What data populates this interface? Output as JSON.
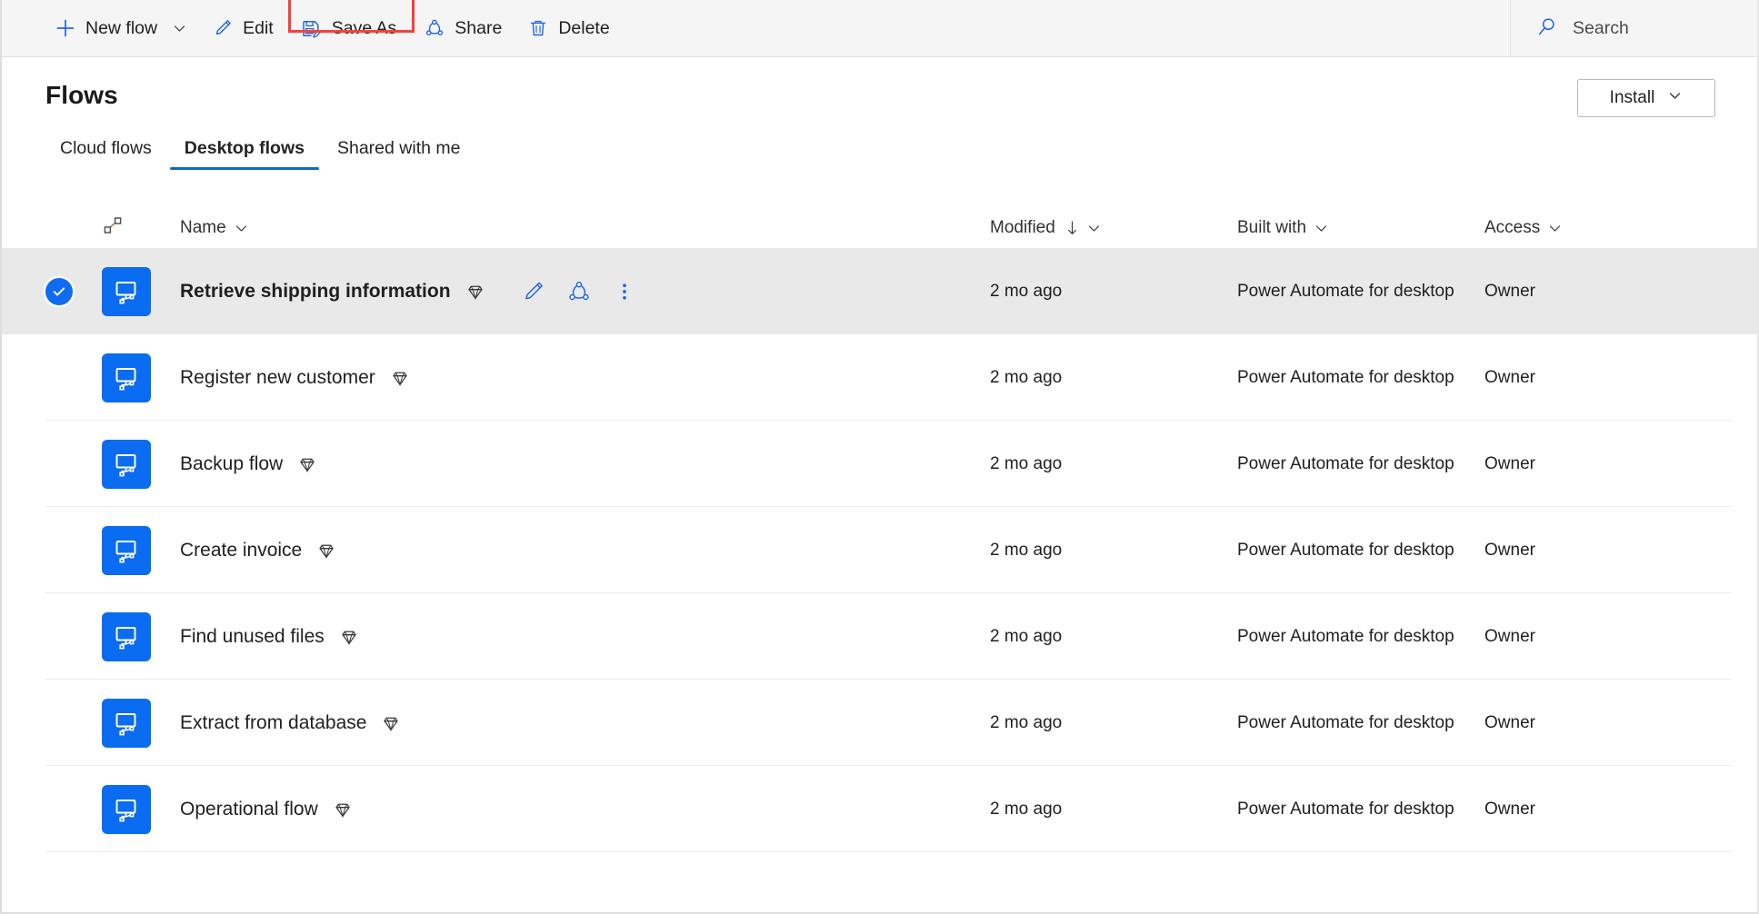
{
  "commandbar": {
    "items": [
      {
        "label": "New flow",
        "icon": "plus-icon",
        "has_caret": true
      },
      {
        "label": "Edit",
        "icon": "pencil-icon",
        "has_caret": false
      },
      {
        "label": "Save As",
        "icon": "save-as-icon",
        "has_caret": false,
        "highlighted": true
      },
      {
        "label": "Share",
        "icon": "share-icon",
        "has_caret": false
      },
      {
        "label": "Delete",
        "icon": "trash-icon",
        "has_caret": false
      }
    ],
    "search": {
      "label": "Search",
      "icon": "search-icon"
    },
    "highlight_color": "#f5413c"
  },
  "header": {
    "title": "Flows",
    "install_button": {
      "label": "Install",
      "icon": "chevron-down-icon"
    }
  },
  "tabs": [
    {
      "label": "Cloud flows",
      "active": false
    },
    {
      "label": "Desktop flows",
      "active": true
    },
    {
      "label": "Shared with me",
      "active": false
    }
  ],
  "table": {
    "columns": {
      "type_icon": "flow-type-icon",
      "name": "Name",
      "modified": "Modified",
      "modified_sort": "descending",
      "built_with": "Built with",
      "access": "Access"
    },
    "row_actions": [
      {
        "name": "edit",
        "icon": "pencil-icon"
      },
      {
        "name": "share",
        "icon": "share-icon"
      },
      {
        "name": "more",
        "icon": "more-vertical-icon"
      }
    ],
    "rows": [
      {
        "name": "Retrieve shipping information",
        "premium": true,
        "modified": "2 mo ago",
        "built_with": "Power Automate for desktop",
        "access": "Owner",
        "selected": true
      },
      {
        "name": "Register new customer",
        "premium": true,
        "modified": "2 mo ago",
        "built_with": "Power Automate for desktop",
        "access": "Owner",
        "selected": false
      },
      {
        "name": "Backup flow",
        "premium": true,
        "modified": "2 mo ago",
        "built_with": "Power Automate for desktop",
        "access": "Owner",
        "selected": false
      },
      {
        "name": "Create invoice",
        "premium": true,
        "modified": "2 mo ago",
        "built_with": "Power Automate for desktop",
        "access": "Owner",
        "selected": false
      },
      {
        "name": "Find unused files",
        "premium": true,
        "modified": "2 mo ago",
        "built_with": "Power Automate for desktop",
        "access": "Owner",
        "selected": false
      },
      {
        "name": "Extract from database",
        "premium": true,
        "modified": "2 mo ago",
        "built_with": "Power Automate for desktop",
        "access": "Owner",
        "selected": false
      },
      {
        "name": "Operational flow",
        "premium": true,
        "modified": "2 mo ago",
        "built_with": "Power Automate for desktop",
        "access": "Owner",
        "selected": false
      }
    ]
  },
  "colors": {
    "accent_blue": "#0f6cbd",
    "icon_blue": "#2266e3",
    "flow_tile_blue": "#0a6cf0",
    "selected_row": "#e9e9e9",
    "commandbar_bg": "#f5f5f5"
  }
}
